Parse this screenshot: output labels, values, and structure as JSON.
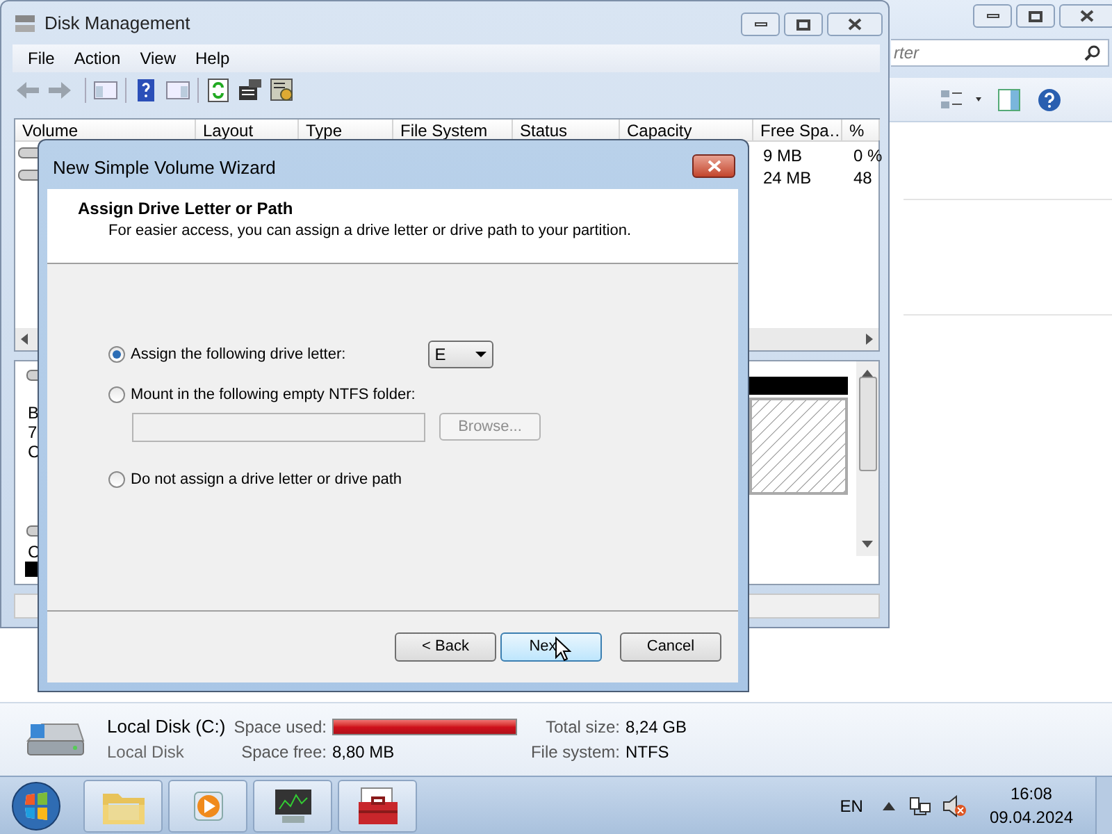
{
  "explorer": {
    "search": {
      "placeholder": "rter"
    }
  },
  "disk_management": {
    "title": "Disk Management",
    "menu": [
      "File",
      "Action",
      "View",
      "Help"
    ],
    "table": {
      "columns": [
        "Volume",
        "Layout",
        "Type",
        "File System",
        "Status",
        "Capacity",
        "Free Spa…",
        "%"
      ],
      "rows": [
        {
          "free_space": "9 MB",
          "percent_free": "0 %"
        },
        {
          "free_space": "24 MB",
          "percent_free": "48"
        }
      ]
    },
    "graphical_view": {
      "disk_0": [
        "B",
        "7",
        "C"
      ],
      "disk_1": [
        "C"
      ]
    }
  },
  "wizard": {
    "title": "New Simple Volume Wizard",
    "heading": "Assign Drive Letter or Path",
    "subtitle": "For easier access, you can assign a drive letter or drive path to your partition.",
    "options": [
      {
        "label": "Assign the following drive letter:",
        "selected": true,
        "kind": "letter"
      },
      {
        "label": "Mount in the following empty NTFS folder:",
        "selected": false,
        "kind": "folder"
      },
      {
        "label": "Do not assign a drive letter or drive path",
        "selected": false,
        "kind": "plain"
      }
    ],
    "drive_letter": "E",
    "folder_field": {
      "disabled": true
    },
    "browse": {
      "label": "Browse...",
      "disabled": true
    },
    "buttons": [
      {
        "label": "< Back",
        "hovered": false
      },
      {
        "label": "Nex",
        "hovered": true
      },
      {
        "label": "Cancel",
        "hovered": false
      }
    ]
  },
  "details": {
    "name": "Local Disk (C:)",
    "type": "Local Disk",
    "space_used_label": "Space used:",
    "level": 1,
    "space_free_label": "Space free:",
    "space_free": "8,80 MB",
    "total_size_label": "Total size:",
    "total_size": "8,24 GB",
    "file_system_label": "File system:",
    "file_system": "NTFS"
  },
  "taskbar": {
    "apps": [
      {
        "kind": "folder"
      },
      {
        "kind": "media"
      },
      {
        "kind": "monitor"
      },
      {
        "kind": "toolbox"
      }
    ],
    "language": "EN",
    "time": "16:08",
    "date": "09.04.2024"
  }
}
